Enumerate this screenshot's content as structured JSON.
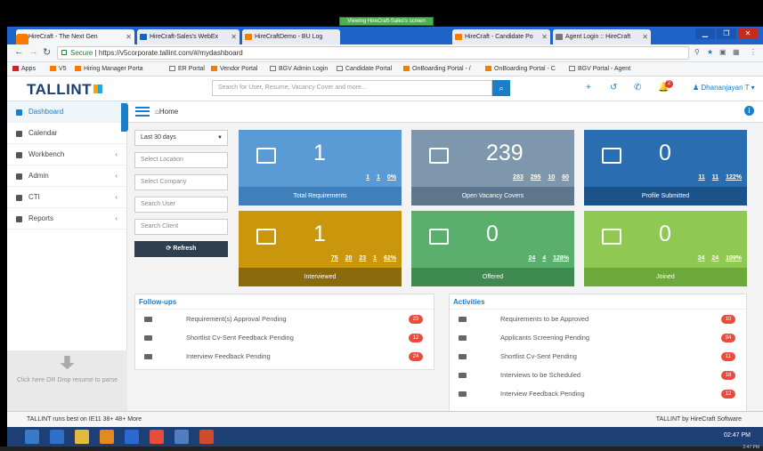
{
  "share_bar": "Viewing HireCraft-Sales's screen",
  "browser": {
    "tabs": [
      {
        "label": "HireCraft - The Next Gen",
        "color": "#f57c00",
        "active": true
      },
      {
        "label": "HireCraft-Sales's WebEx",
        "color": "#1565c0",
        "active": false
      },
      {
        "label": "HireCraftDemo - BU Log",
        "color": "#f57c00",
        "active": false
      },
      {
        "label": "HireCraft - Candidate Po",
        "color": "#f57c00",
        "active": false
      },
      {
        "label": "Agent Login :: HireCraft",
        "color": "#777777",
        "active": false
      }
    ],
    "address": {
      "secure_label": "Secure",
      "url": "https://v5corporate.tallint.com/#/mydashboard"
    },
    "bookmarks": [
      {
        "label": "Apps"
      },
      {
        "label": "V5"
      },
      {
        "label": "Hiring Manager Porta"
      },
      {
        "label": "ER Portal"
      },
      {
        "label": "Vendor Portal"
      },
      {
        "label": "BGV Admin Login"
      },
      {
        "label": "Candidate Portal"
      },
      {
        "label": "OnBoarding Portal - /"
      },
      {
        "label": "OnBoarding Portal - C"
      },
      {
        "label": "BGV Portal - Agent"
      }
    ]
  },
  "app": {
    "logo": "TALLINT",
    "search_placeholder": "Search for User, Resume, Vacancy Cover and more...",
    "notification_count": "2",
    "user_name": "Dhananjayan T",
    "breadcrumb": "Home",
    "sidebar": {
      "items": [
        {
          "label": "Dashboard"
        },
        {
          "label": "Calendar"
        },
        {
          "label": "Workbench"
        },
        {
          "label": "Admin"
        },
        {
          "label": "CTI"
        },
        {
          "label": "Reports"
        }
      ],
      "drop_text": "Click here OR Drop resume to parse"
    },
    "filters": {
      "period": "Last 30 days",
      "location": "Select Location",
      "company": "Select Company",
      "user": "Search User",
      "client": "Search Client",
      "refresh": "Refresh"
    },
    "cards": [
      {
        "label": "Total Requirements",
        "value": "1",
        "sub": [
          "1",
          "1",
          "0%"
        ],
        "bg": "#5b9bd5",
        "foot": "#3e7fbc"
      },
      {
        "label": "Open Vacancy Covers",
        "value": "239",
        "sub": [
          "283",
          "295",
          "10",
          "60"
        ],
        "bg": "#7f97ad",
        "foot": "#5e778e"
      },
      {
        "label": "Profile Submitted",
        "value": "0",
        "sub": [
          "11",
          "11",
          "122%"
        ],
        "bg": "#2a6db0",
        "foot": "#1b528a"
      },
      {
        "label": "Interviewed",
        "value": "1",
        "sub": [
          "75",
          "20",
          "23",
          "1",
          "62%"
        ],
        "bg": "#c9960c",
        "foot": "#8a6a0a"
      },
      {
        "label": "Offered",
        "value": "0",
        "sub": [
          "24",
          "4",
          "128%"
        ],
        "bg": "#5aaf6c",
        "foot": "#3e8a50"
      },
      {
        "label": "Joined",
        "value": "0",
        "sub": [
          "24",
          "24",
          "109%"
        ],
        "bg": "#8fc853",
        "foot": "#6da83a"
      }
    ],
    "followups": {
      "title": "Follow-ups",
      "rows": [
        {
          "label": "Requirement(s) Approval Pending",
          "count": "23"
        },
        {
          "label": "Shortlist Cv-Sent Feedback Pending",
          "count": "12"
        },
        {
          "label": "Interview Feedback Pending",
          "count": "24"
        }
      ]
    },
    "activities": {
      "title": "Activities",
      "rows": [
        {
          "label": "Requirements to be Approved",
          "count": "10"
        },
        {
          "label": "Applicants Screening Pending",
          "count": "94"
        },
        {
          "label": "Shortlist Cv-Sent Pending",
          "count": "11"
        },
        {
          "label": "Interviews to be Scheduled",
          "count": "18"
        },
        {
          "label": "Interview Feedback Pending",
          "count": "12"
        }
      ]
    },
    "footer_left": "TALLINT runs best on IE11 38+ 48+ More",
    "footer_right": "TALLINT by HireCraft Software"
  },
  "taskbar": {
    "time": "02:47 PM"
  },
  "corner_time": "2:47 PM"
}
